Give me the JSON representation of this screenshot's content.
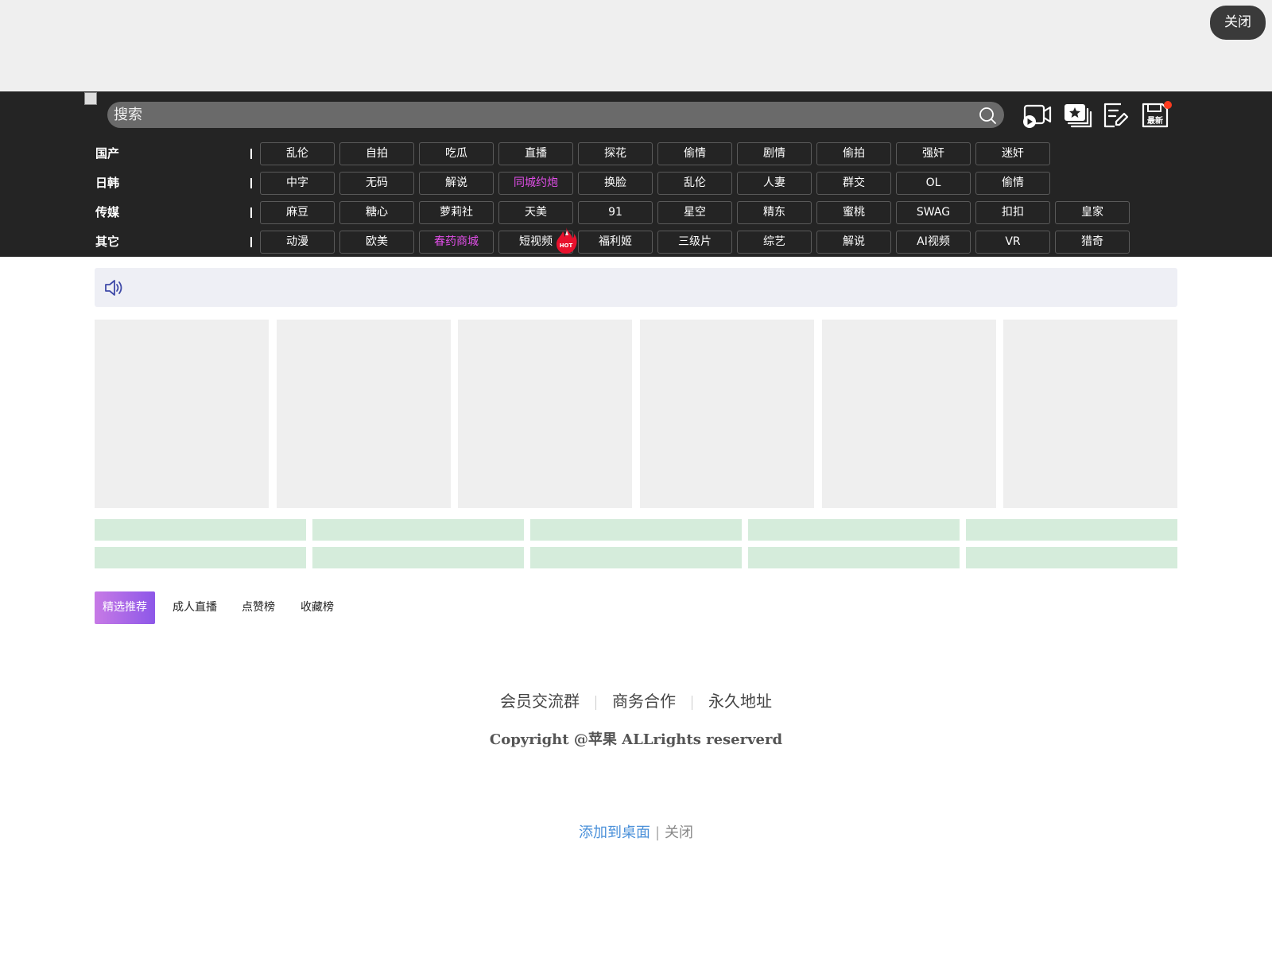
{
  "banner": {
    "close_label": "关闭"
  },
  "header": {
    "search_placeholder": "搜索",
    "icons": [
      "video-upload-icon",
      "gallery-star-icon",
      "note-edit-icon",
      "latest-save-icon"
    ],
    "latest_label": "最新",
    "badge_color": "#ff3b1f"
  },
  "nav": {
    "rows": [
      {
        "label": "国产",
        "tags": [
          "乱伦",
          "自拍",
          "吃瓜",
          "直播",
          "探花",
          "偷情",
          "剧情",
          "偷拍",
          "强奸",
          "迷奸"
        ]
      },
      {
        "label": "日韩",
        "tags": [
          "中字",
          "无码",
          "解说",
          "同城约炮",
          "换脸",
          "乱伦",
          "人妻",
          "群交",
          "OL",
          "偷情"
        ]
      },
      {
        "label": "传媒",
        "tags": [
          "麻豆",
          "糖心",
          "萝莉社",
          "天美",
          "91",
          "星空",
          "精东",
          "蜜桃",
          "SWAG",
          "扣扣",
          "皇家"
        ]
      },
      {
        "label": "其它",
        "tags": [
          "动漫",
          "欧美",
          "春药商城",
          "短视频",
          "福利姬",
          "三级片",
          "综艺",
          "解说",
          "AI视频",
          "VR",
          "猎奇"
        ]
      }
    ],
    "highlight_color": "#e14ee8",
    "hot_label": "HOT"
  },
  "tabs": [
    "精选推荐",
    "成人直播",
    "点赞榜",
    "收藏榜"
  ],
  "footer": {
    "links": [
      "会员交流群",
      "商务合作",
      "永久地址"
    ],
    "copyright": "Copyright @苹果 ALLrights reserverd",
    "add_to_desktop": "添加到桌面",
    "sep": "|",
    "close": "关闭"
  }
}
